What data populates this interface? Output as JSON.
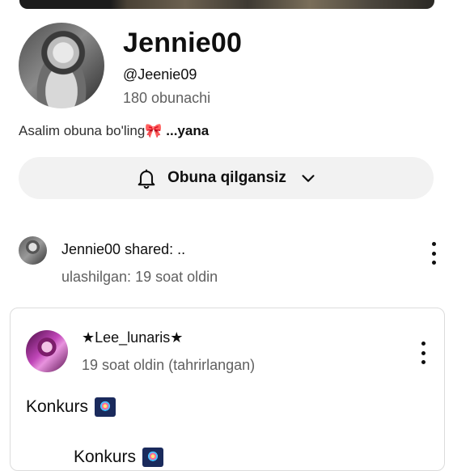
{
  "channel": {
    "name": "Jennie00",
    "handle": "@Jeenie09",
    "subscribers": "180 obunachi",
    "description": "Asalim obuna bo'ling",
    "description_emoji": "🎀",
    "description_more": "...yana"
  },
  "subscribe_button": {
    "label": "Obuna qilgansiz",
    "icon": "bell-icon",
    "dropdown_icon": "chevron-down-icon"
  },
  "shared_post": {
    "title": "Jennie00 shared: ..",
    "time": "ulashilgan: 19 soat oldin"
  },
  "original_post": {
    "author": "★Lee_lunaris★",
    "time": "19 soat oldin (tahrirlangan)",
    "text": "Konkurs",
    "text_partial": "Konkurs"
  }
}
